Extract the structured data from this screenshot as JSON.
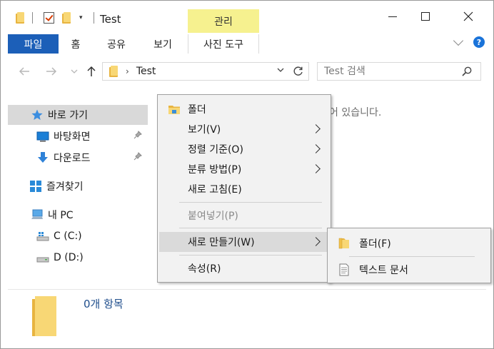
{
  "title_bar": {
    "title": "Test",
    "minimize_icon": "minimize-icon",
    "maximize_icon": "maximize-icon",
    "close_icon": "close-icon"
  },
  "ribbon": {
    "contextual_group": "관리",
    "tabs": [
      {
        "label": "파일"
      },
      {
        "label": "홈"
      },
      {
        "label": "공유"
      },
      {
        "label": "보기"
      },
      {
        "label": "사진 도구"
      }
    ]
  },
  "address_bar": {
    "path": "Test",
    "search_placeholder": "Test 검색"
  },
  "sidebar": {
    "items": [
      {
        "label": "바로 가기"
      },
      {
        "label": "바탕화면"
      },
      {
        "label": "다운로드"
      },
      {
        "label": "즐겨찾기"
      },
      {
        "label": "내 PC"
      },
      {
        "label": "C (C:)"
      },
      {
        "label": "D (D:)"
      }
    ]
  },
  "main": {
    "empty_message": "어 있습니다."
  },
  "status": {
    "item_count": "0개 항목"
  },
  "context_menu": {
    "items": [
      {
        "label": "폴더"
      },
      {
        "label": "보기(V)"
      },
      {
        "label": "정렬 기준(O)"
      },
      {
        "label": "분류 방법(P)"
      },
      {
        "label": "새로 고침(E)"
      },
      {
        "label": "붙여넣기(P)"
      },
      {
        "label": "새로 만들기(W)"
      },
      {
        "label": "속성(R)"
      }
    ]
  },
  "submenu": {
    "items": [
      {
        "label": "폴더(F)"
      },
      {
        "label": "텍스트 문서"
      }
    ]
  },
  "colors": {
    "file_tab": "#1c5fb8",
    "contextual_tab": "#f6f18f",
    "selected_bg": "#d9d9d9",
    "menu_bg": "#f2f2f2",
    "help": "#1a73d9"
  }
}
